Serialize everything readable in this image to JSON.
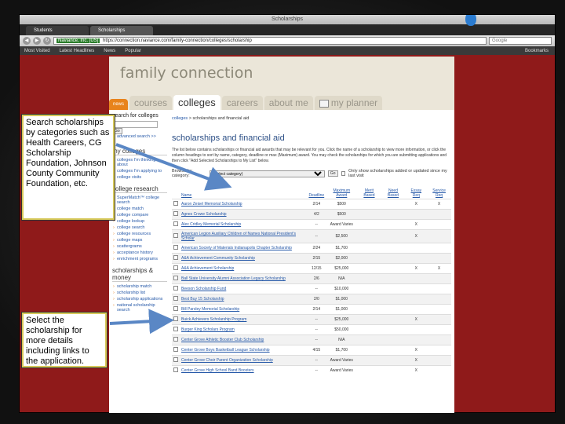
{
  "window": {
    "title": "Scholarships"
  },
  "tabs": [
    {
      "label": "Students"
    },
    {
      "label": "Scholarships"
    }
  ],
  "navbar": {
    "url_host": "Naviance, Inc. [US]",
    "url": "https://connection.naviance.com/family-connection/colleges/scholarship",
    "search_placeholder": "Google"
  },
  "bookmarks": {
    "items": [
      "Most Visited",
      "Latest Headlines",
      "News",
      "Popular"
    ],
    "right": "Bookmarks"
  },
  "fc": {
    "logo": "family connection",
    "tabs": {
      "news": "news",
      "courses": "courses",
      "colleges": "colleges",
      "careers": "careers",
      "about": "about me",
      "planner": "my planner"
    }
  },
  "left": {
    "search_title": "search for colleges",
    "search_value": "Go",
    "advanced": "advanced search >>",
    "my_colleges_title": "my colleges",
    "my_colleges": [
      "colleges I'm thinking about",
      "colleges I'm applying to",
      "college visits"
    ],
    "research_title": "college research",
    "research": [
      "SuperMatch™ college search",
      "college match",
      "college compare",
      "college lookup",
      "college search",
      "college resources",
      "college maps",
      "scattergrams",
      "acceptance history",
      "enrichment programs"
    ],
    "scholarships_title": "scholarships & money",
    "scholarships": [
      "scholarship match",
      "scholarship list",
      "scholarship applications",
      "national scholarship search"
    ]
  },
  "main": {
    "breadcrumb_home": "colleges",
    "breadcrumb_current": "scholarships and financial aid",
    "title": "scholarships and financial aid",
    "intro": "The list below contains scholarships or financial aid awards that may be relevant for you. Click the name of a scholarship to view more information, or click the column headings to sort by name, category, deadline or max (Maximum) award. You may check the scholarships for which you are submitting applications and then click \"Add Selected Scholarships to My List\" below.",
    "filter_label": "Browse by category:",
    "filter_value": "(select category)",
    "go": "Go",
    "only_added": "Only show scholarships added or updated since my last visit",
    "columns": [
      "Name",
      "Deadline",
      "Maximum Award",
      "Merit Based",
      "Need Based",
      "Essay Req",
      "Service Req"
    ],
    "rows": [
      [
        "Aaron Zeisel Memorial Scholarship",
        "2/14",
        "$500",
        "",
        "",
        "X",
        "X"
      ],
      [
        "Agnes Crowe Scholarship",
        "4/2",
        "$500",
        "",
        "",
        "",
        ""
      ],
      [
        "Alex Cridley Memorial Scholarship",
        "--",
        "Award Varies",
        "",
        "",
        "X",
        ""
      ],
      [
        "American Legion Auxiliary Children of Names National President's Scholar",
        "--",
        "$2,500",
        "",
        "",
        "X",
        ""
      ],
      [
        "American Society of Materials Indianapolis Chapter Scholarship",
        "2/24",
        "$1,700",
        "",
        "",
        "",
        ""
      ],
      [
        "A&A Achievement Community Scholarship",
        "2/15",
        "$2,000",
        "",
        "",
        "",
        ""
      ],
      [
        "A&A Achievement Scholarship",
        "12/15",
        "$25,000",
        "",
        "",
        "X",
        "X"
      ],
      [
        "Ball State University Alumni Association Legacy Scholarship",
        "2/6",
        "N/A",
        "",
        "",
        "",
        ""
      ],
      [
        "Beeson Scholarship Fund",
        "--",
        "$10,000",
        "",
        "",
        "",
        ""
      ],
      [
        "Best Buy 15 Scholarship",
        "2/0",
        "$1,000",
        "",
        "",
        "",
        ""
      ],
      [
        "Bill Parsley Memorial Scholarship",
        "2/14",
        "$1,000",
        "",
        "",
        "",
        ""
      ],
      [
        "Buick Achievers Scholarship Program",
        "--",
        "$25,000",
        "",
        "",
        "X",
        ""
      ],
      [
        "Burger King Scholars Program",
        "--",
        "$50,000",
        "",
        "",
        "",
        ""
      ],
      [
        "Center Grove Athletic Booster Club Scholarship",
        "--",
        "N/A",
        "",
        "",
        "",
        ""
      ],
      [
        "Center Grove Boys Basketball League Scholarship",
        "4/15",
        "$1,700",
        "",
        "",
        "X",
        ""
      ],
      [
        "Center Grove Choir Parent Organization Scholarship",
        "--",
        "Award Varies",
        "",
        "",
        "X",
        ""
      ],
      [
        "Center Grove High School Band Boosters",
        "--",
        "Award Varies",
        "",
        "",
        "X",
        ""
      ]
    ]
  },
  "callouts": {
    "first": "Search scholarships by categories such as Health Careers, CG Scholarship Foundation, Johnson County Community Foundation, etc.",
    "second": "Select the scholarship for more details including links to the application."
  },
  "colors": {
    "frame": "#8f1a1a",
    "accent": "#e8831c",
    "link": "#2558a8"
  }
}
